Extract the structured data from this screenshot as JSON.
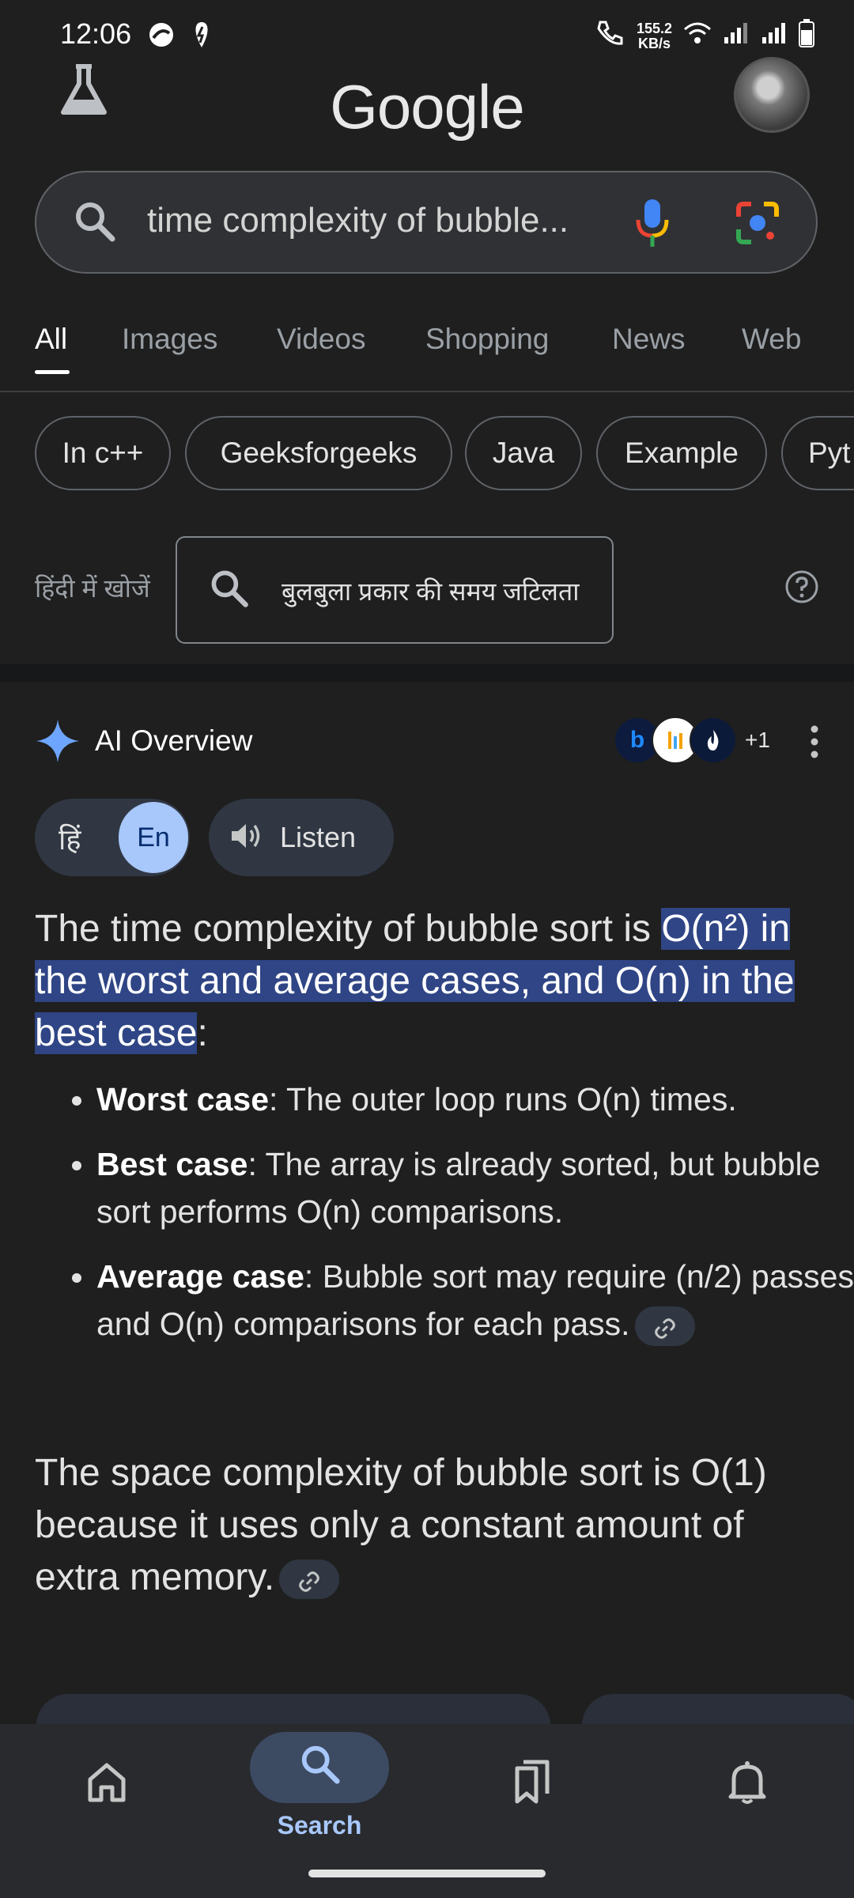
{
  "status_bar": {
    "time": "12:06",
    "net_speed_value": "155.2",
    "net_speed_unit": "KB/s"
  },
  "header": {
    "logo": "Google",
    "search_query": "time complexity of bubble..."
  },
  "tabs": [
    "All",
    "Images",
    "Videos",
    "Shopping",
    "News",
    "Web"
  ],
  "chips": [
    "In c++",
    "Geeksforgeeks",
    "Java",
    "Example",
    "Pyt"
  ],
  "hindi_search": {
    "label": "हिंदी में खोजें",
    "query": "बुलबुला प्रकार की समय जटिलता"
  },
  "ai_overview": {
    "title": "AI Overview",
    "sources_more": "+1",
    "lang_hi": "हिं",
    "lang_en": "En",
    "listen_label": "Listen",
    "intro_pre": "The time complexity of bubble sort is ",
    "intro_highlight": "O(n²) in the worst and average cases, and O(n) in the best case",
    "intro_post": ":",
    "bullets": [
      {
        "term": "Worst case",
        "text": ": The outer loop runs O(n) times."
      },
      {
        "term": "Best case",
        "text": ": The array is already sorted, but bubble sort performs O(n) comparisons."
      },
      {
        "term": "Average case",
        "text": ": Bubble sort may require (n/2) passes and O(n) comparisons for each pass."
      }
    ],
    "space_text": "The space complexity of bubble sort is O(1) because it uses only a constant amount of extra memory."
  },
  "bottom_nav": {
    "search_label": "Search"
  },
  "colors": {
    "background": "#1f1f1f",
    "highlight": "#2f4585",
    "accent": "#a8c7fa"
  }
}
